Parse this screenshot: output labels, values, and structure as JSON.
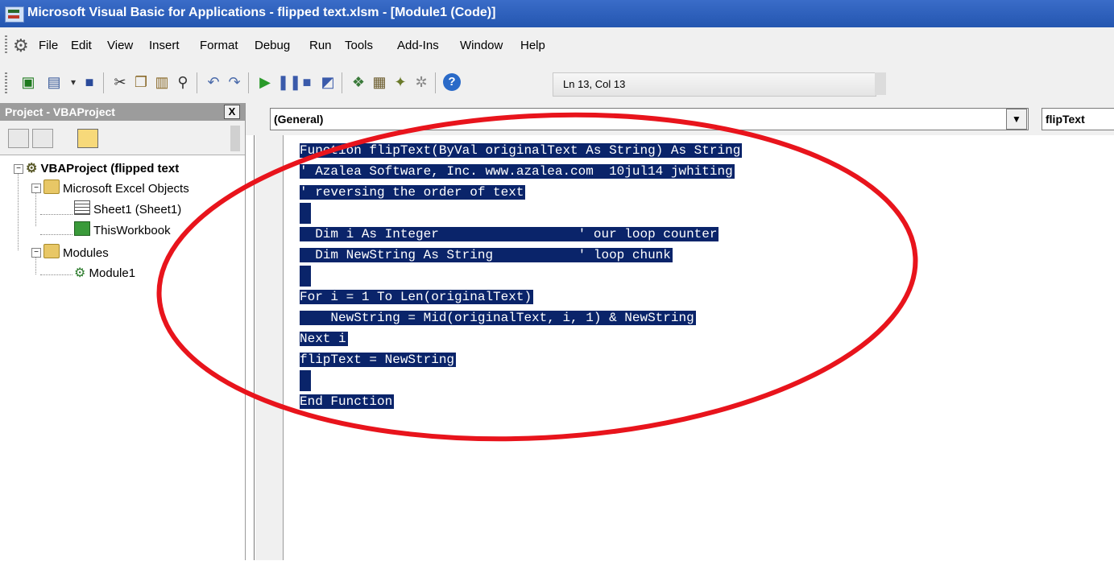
{
  "window": {
    "title": "Microsoft Visual Basic for Applications - flipped text.xlsm - [Module1 (Code)]"
  },
  "menu": {
    "items": [
      "File",
      "Edit",
      "View",
      "Insert",
      "Format",
      "Debug",
      "Run",
      "Tools",
      "Add-Ins",
      "Window",
      "Help"
    ]
  },
  "toolbar": {
    "position_text": "Ln 13, Col 13",
    "icons": [
      "excel-view-icon",
      "insert-userform-icon",
      "save-icon",
      "cut-icon",
      "copy-icon",
      "paste-icon",
      "find-icon",
      "undo-icon",
      "redo-icon",
      "run-icon",
      "break-icon",
      "reset-icon",
      "design-mode-icon",
      "project-explorer-icon",
      "properties-icon",
      "object-browser-icon",
      "toolbox-icon",
      "help-icon"
    ]
  },
  "project_explorer": {
    "title": "Project - VBAProject",
    "close_glyph": "X",
    "tree": {
      "project": "VBAProject (flipped text",
      "excel_objects": "Microsoft Excel Objects",
      "sheet1": "Sheet1 (Sheet1)",
      "workbook": "ThisWorkbook",
      "modules": "Modules",
      "module1": "Module1"
    }
  },
  "code_window": {
    "object_combo": "(General)",
    "procedure_combo": "flipText",
    "lines": [
      "Function flipText(ByVal originalText As String) As String",
      "' Azalea Software, Inc. www.azalea.com  10jul14 jwhiting",
      "' reversing the order of text",
      "",
      "  Dim i As Integer                  ' our loop counter",
      "  Dim NewString As String           ' loop chunk",
      "",
      "For i = 1 To Len(originalText)",
      "    NewString = Mid(originalText, i, 1) & NewString",
      "Next i",
      "flipText = NewString",
      "",
      "End Function"
    ]
  },
  "colors": {
    "selection": "#0a246a",
    "annotation": "#e8141c",
    "titlebar": "#2456b0"
  }
}
